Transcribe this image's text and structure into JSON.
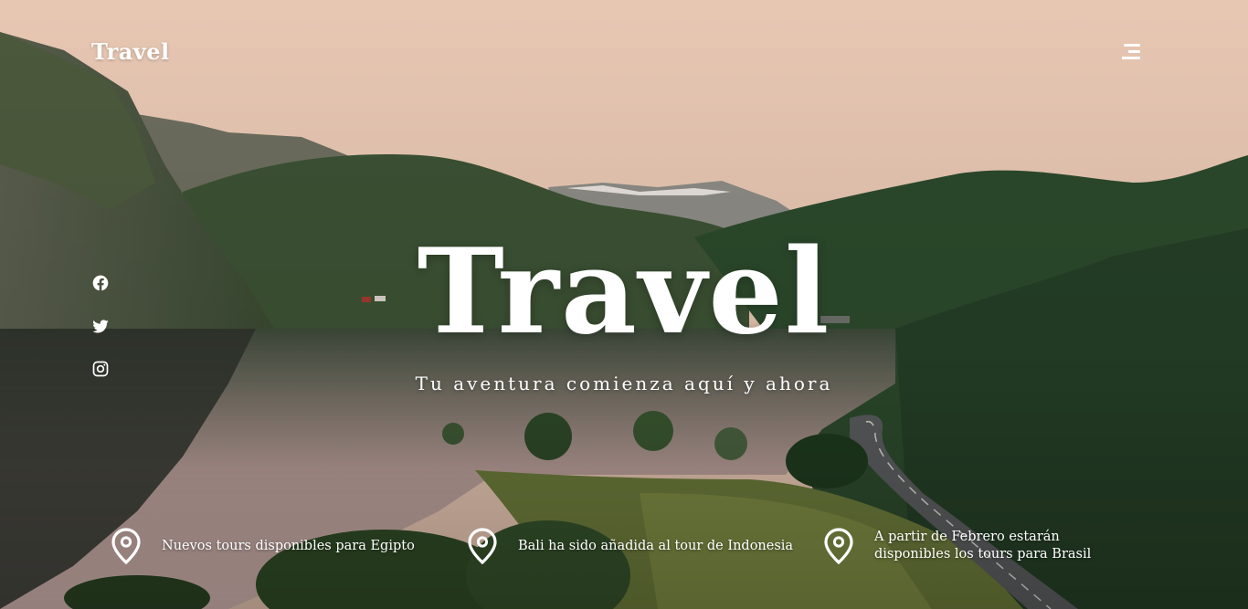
{
  "header": {
    "brand": "Travel",
    "menu_icon": "hamburger-menu-icon"
  },
  "social": [
    {
      "icon": "facebook-icon"
    },
    {
      "icon": "twitter-icon"
    },
    {
      "icon": "instagram-icon"
    }
  ],
  "hero": {
    "title": "Travel",
    "subtitle": "Tu aventura comienza aquí y ahora"
  },
  "news": [
    {
      "icon": "map-pin-icon",
      "text": "Nuevos tours disponibles para Egipto"
    },
    {
      "icon": "map-pin-icon",
      "text": "Bali ha sido añadida al tour de Indonesia"
    },
    {
      "icon": "map-pin-icon",
      "text": "A partir de Febrero estarán disponibles los tours para Brasil"
    }
  ],
  "colors": {
    "text": "#ffffff",
    "sky": "#ecc9b4",
    "forest": "#2c4a2c"
  }
}
